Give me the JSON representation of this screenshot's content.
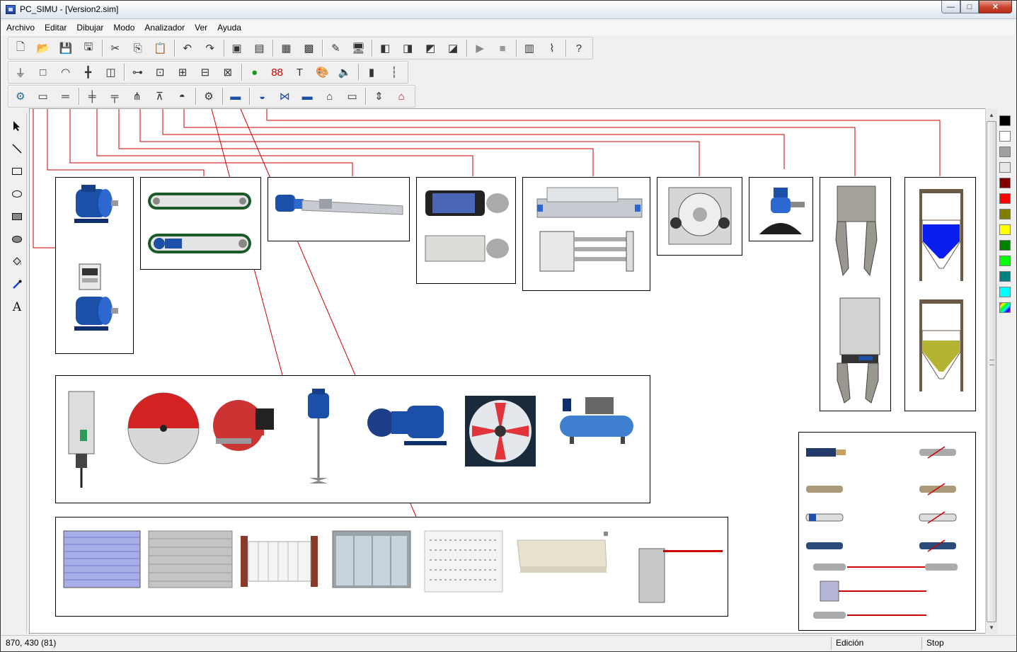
{
  "window": {
    "title": "PC_SIMU - [Version2.sim]"
  },
  "menu": [
    "Archivo",
    "Editar",
    "Dibujar",
    "Modo",
    "Analizador",
    "Ver",
    "Ayuda"
  ],
  "toolbar1": [
    "new-icon",
    "open-icon",
    "save-icon",
    "save-as-icon",
    "sep",
    "cut-icon",
    "copy-icon",
    "paste-icon",
    "sep",
    "undo-icon",
    "redo-icon",
    "sep",
    "bring-front-icon",
    "send-back-icon",
    "sep",
    "grid-icon",
    "grid-snap-icon",
    "sep",
    "pencil-icon",
    "monitor-icon",
    "sep",
    "cube-icon",
    "cube2-icon",
    "cube3-icon",
    "cube4-icon",
    "sep",
    "play-icon",
    "stop-icon",
    "sep",
    "analyzer-icon",
    "chart-icon",
    "sep",
    "help-icon"
  ],
  "toolbar2": [
    "switch-icon",
    "panel-icon",
    "arc-icon",
    "cross-icon",
    "cylinder-icon",
    "sep",
    "valve1-icon",
    "valve2-icon",
    "valve3-icon",
    "valve4-icon",
    "valve5-icon",
    "sep",
    "led-icon",
    "display-icon",
    "text-icon",
    "palette-icon",
    "speaker-icon",
    "sep",
    "gauge-icon",
    "scale-icon"
  ],
  "toolbar3": [
    "motor-icon",
    "conveyor-icon",
    "belt-icon",
    "sep",
    "cylinder-lin-icon",
    "cylinder-lin2-icon",
    "gripper-icon",
    "press-icon",
    "bin-icon",
    "sep",
    "gear-icon",
    "sep",
    "panel-blue-icon",
    "sep",
    "tank-icon",
    "valve-blue-icon",
    "bar-icon",
    "factory-icon",
    "ruler-icon",
    "sep",
    "elevator-icon",
    "house-icon"
  ],
  "tools": [
    "select-arrow-icon",
    "line-icon",
    "rectangle-icon",
    "ellipse-icon",
    "filled-rectangle-icon",
    "filled-ellipse-icon",
    "fill-bucket-icon",
    "eyedropper-icon",
    "text-tool-icon"
  ],
  "tool_glyphs": {
    "text_tool": "A"
  },
  "colors": [
    "#000000",
    "#ffffff",
    "#a0a0a0",
    "#e8e8e8",
    "#800000",
    "#ff0000",
    "#808000",
    "#ffff00",
    "#008000",
    "#00ff00",
    "#008080",
    "#00ffff",
    "rainbow"
  ],
  "status": {
    "coords": "870, 430 (81)",
    "mode": "Edición",
    "run_state": "Stop"
  }
}
